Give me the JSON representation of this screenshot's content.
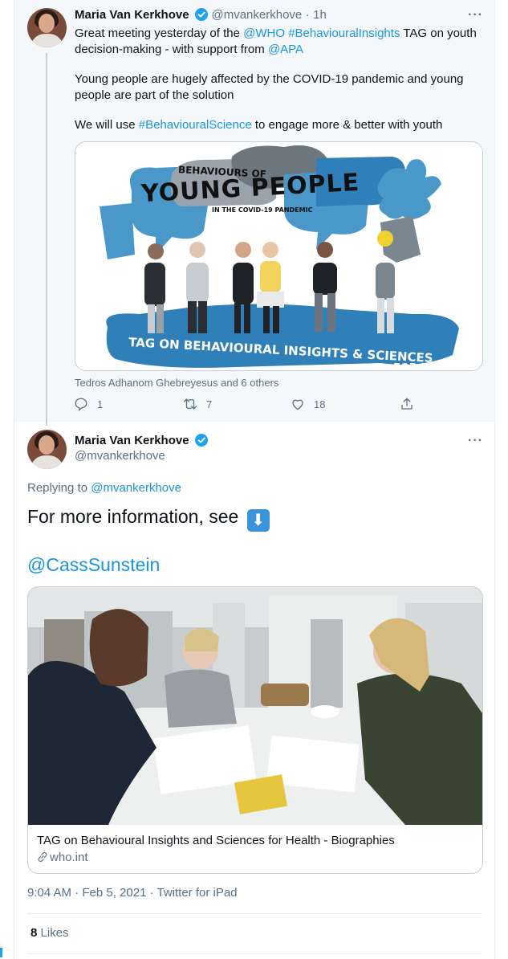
{
  "tweet1": {
    "author_name": "Maria Van Kerkhove",
    "handle": "@mvankerkhove",
    "separator": "·",
    "time": "1h",
    "line1": {
      "t1": "Great meeting yesterday of the ",
      "m1": "@WHO",
      "h1": "#BehaviouralInsights",
      "t2": " TAG on youth decision-making - with support from ",
      "m2": "@APA"
    },
    "para2": "Young people are hugely affected by the COVID-19 pandemic and young people are part of the solution",
    "para3": {
      "t1": "We will use ",
      "h1": "#BehaviouralScience",
      "t2": " to engage more & better with youth"
    },
    "image_text": {
      "top": "BEHAVIOURS OF",
      "main": "YOUNG PEOPLE",
      "sub": "IN THE COVID-19 PANDEMIC",
      "bottom": "TAG ON BEHAVIOURAL INSIGHTS & SCIENCES",
      "bottom2": "FOR HEA"
    },
    "tagged": "Tedros Adhanom Ghebreyesus and 6 others",
    "replies": "1",
    "retweets": "7",
    "likes": "18"
  },
  "tweet2": {
    "author_name": "Maria Van Kerkhove",
    "handle": "@mvankerkhove",
    "replying_prefix": "Replying to ",
    "replying_to": "@mvankerkhove",
    "text": "For more information, see",
    "emoji_arrow": "⬇",
    "mention": "@CassSunstein",
    "card_title": "TAG on Behavioural Insights and Sciences for Health - Biographies",
    "card_domain": "who.int",
    "timestamp": "9:04 AM · Feb 5, 2021 · Twitter for iPad",
    "likes_count": "8",
    "likes_label": "Likes"
  },
  "colors": {
    "link": "#1b95e0",
    "verified": "#1da1f2",
    "muted": "#5b7083",
    "thread_bg": "#f5f8fa"
  }
}
